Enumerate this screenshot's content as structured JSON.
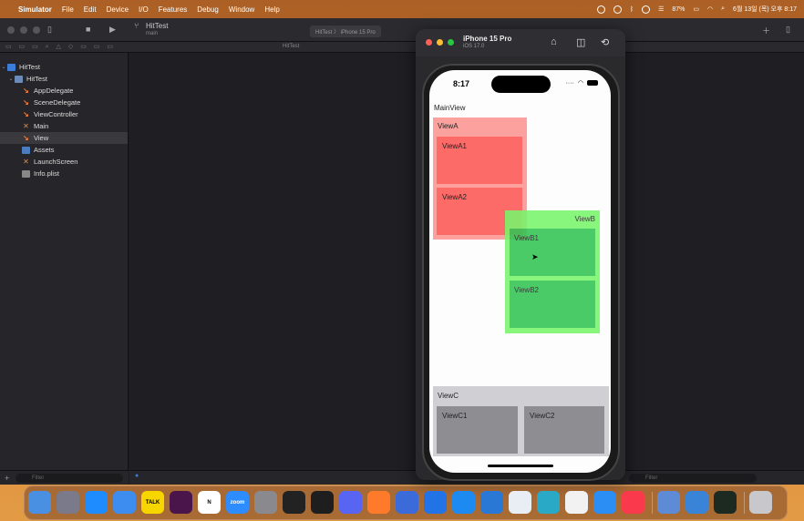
{
  "menubar": {
    "apple": "",
    "items": [
      "Simulator",
      "File",
      "Edit",
      "Device",
      "I/O",
      "Features",
      "Debug",
      "Window",
      "Help"
    ],
    "battery": "87%",
    "datetime": "6월 13일 (목) 오후 8:17"
  },
  "xcode": {
    "project_name": "HitTest",
    "branch": "main",
    "scheme": "HitTest 〉 iPhone 15 Pro",
    "file_tab": "HitTest",
    "navigator": [
      {
        "label": "HitTest",
        "kind": "project",
        "indent": 0,
        "disclosure": "⌄"
      },
      {
        "label": "HitTest",
        "kind": "folder",
        "indent": 1,
        "disclosure": "⌄"
      },
      {
        "label": "AppDelegate",
        "kind": "swift",
        "indent": 2,
        "disclosure": ""
      },
      {
        "label": "SceneDelegate",
        "kind": "swift",
        "indent": 2,
        "disclosure": ""
      },
      {
        "label": "ViewController",
        "kind": "swift",
        "indent": 2,
        "disclosure": ""
      },
      {
        "label": "Main",
        "kind": "storyboard",
        "indent": 2,
        "disclosure": ""
      },
      {
        "label": "View",
        "kind": "swift",
        "indent": 2,
        "disclosure": "",
        "selected": true
      },
      {
        "label": "Assets",
        "kind": "assets",
        "indent": 2,
        "disclosure": ""
      },
      {
        "label": "LaunchScreen",
        "kind": "storyboard",
        "indent": 2,
        "disclosure": ""
      },
      {
        "label": "Info.plist",
        "kind": "plist",
        "indent": 2,
        "disclosure": ""
      }
    ],
    "filter_placeholder": "Filter",
    "editor_filter_placeholder": "Filter"
  },
  "simulator": {
    "device_name": "iPhone 15 Pro",
    "os_version": "iOS 17.0",
    "status_time": "8:17",
    "views": {
      "main": "MainView",
      "a": "ViewA",
      "a1": "ViewA1",
      "a2": "ViewA2",
      "b": "ViewB",
      "b1": "ViewB1",
      "b2": "ViewB2",
      "c": "ViewC",
      "c1": "ViewC1",
      "c2": "ViewC2"
    }
  },
  "colors": {
    "viewA": "#fca19e",
    "viewA_child": "#fd6b68",
    "viewB": "#78f56c",
    "viewB_child": "#33c454",
    "viewC": "#d0d0d4",
    "viewC_child": "#8e8e92"
  },
  "dock": {
    "apps": [
      {
        "name": "finder-icon",
        "label": "",
        "color": "#4a90e2"
      },
      {
        "name": "launchpad-icon",
        "label": "",
        "color": "#7a7a8a"
      },
      {
        "name": "app-store-icon",
        "label": "",
        "color": "#1e8cff"
      },
      {
        "name": "mail-icon",
        "label": "",
        "color": "#3d8df0"
      },
      {
        "name": "kakaotalk-icon",
        "label": "TALK",
        "color": "#f7d600"
      },
      {
        "name": "slack-icon",
        "label": "",
        "color": "#4a154b"
      },
      {
        "name": "notion-icon",
        "label": "N",
        "color": "#ffffff"
      },
      {
        "name": "zoom-icon",
        "label": "zoom",
        "color": "#2d8cff"
      },
      {
        "name": "system-settings-icon",
        "label": "",
        "color": "#8a8a8e"
      },
      {
        "name": "terminal-icon",
        "label": "",
        "color": "#222222"
      },
      {
        "name": "figma-icon",
        "label": "",
        "color": "#1e1e1e"
      },
      {
        "name": "discord-icon",
        "label": "",
        "color": "#5865f2"
      },
      {
        "name": "pencil-app-icon",
        "label": "",
        "color": "#ff7a2a"
      },
      {
        "name": "fork-icon",
        "label": "",
        "color": "#3a6bd8"
      },
      {
        "name": "maps-pin-icon",
        "label": "",
        "color": "#2273e6"
      },
      {
        "name": "app-store-connect-icon",
        "label": "",
        "color": "#1c8af0"
      },
      {
        "name": "xcode-icon",
        "label": "",
        "color": "#2a78d6"
      },
      {
        "name": "proxyman-icon",
        "label": "",
        "color": "#e9eef5"
      },
      {
        "name": "swift-bird-icon",
        "label": "",
        "color": "#29a9c6"
      },
      {
        "name": "vscode-icon",
        "label": "",
        "color": "#f2f2f2"
      },
      {
        "name": "safari-icon",
        "label": "",
        "color": "#2a8ef5"
      },
      {
        "name": "music-icon",
        "label": "",
        "color": "#fa3a4c"
      },
      {
        "name": "preview-icon",
        "label": "",
        "color": "#5e8bd6"
      },
      {
        "name": "simulator-icon",
        "label": "",
        "color": "#3a84d8"
      },
      {
        "name": "activity-monitor-icon",
        "label": "",
        "color": "#1d2a22"
      },
      {
        "name": "trash-icon",
        "label": "",
        "color": "#c8c8cc"
      }
    ]
  }
}
